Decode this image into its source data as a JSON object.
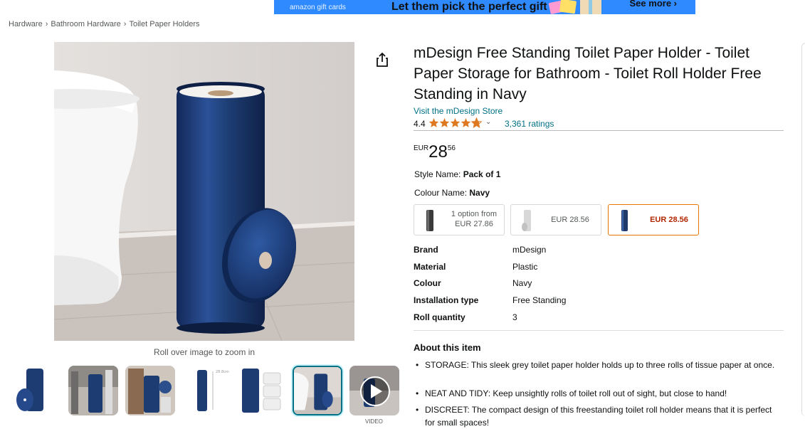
{
  "banner": {
    "small": "amazon gift cards",
    "headline": "Let them pick the perfect gift",
    "more": "See more ›"
  },
  "breadcrumb": [
    "Hardware",
    "Bathroom Hardware",
    "Toilet Paper Holders"
  ],
  "breadcrumb_sep": "›",
  "image": {
    "zoom_note": "Roll over image to zoom in",
    "video_label": "VIDEO",
    "selected_thumb": 6
  },
  "product": {
    "title": "mDesign Free Standing Toilet Paper Holder - Toilet Paper Storage for Bathroom - Toilet Roll Holder Free Standing in Navy",
    "store_link": "Visit the mDesign Store",
    "rating": "4.4",
    "rating_value": 4.4,
    "ratings_count": "3,361 ratings",
    "price": {
      "currency": "EUR",
      "whole": "28",
      "fraction": "56"
    }
  },
  "variants": {
    "style_label": "Style Name:",
    "style_value": "Pack of 1",
    "colour_label": "Colour Name:",
    "colour_value": "Navy",
    "swatches": [
      {
        "line1": "1 option from",
        "line2": "EUR 27.86",
        "color": "#3a3a3a"
      },
      {
        "price": "EUR 28.56",
        "color": "#d8d8d8"
      },
      {
        "price": "EUR 28.56",
        "color": "#1f3a6b",
        "selected": true
      }
    ]
  },
  "specs": [
    {
      "key": "Brand",
      "value": "mDesign"
    },
    {
      "key": "Material",
      "value": "Plastic"
    },
    {
      "key": "Colour",
      "value": "Navy"
    },
    {
      "key": "Installation type",
      "value": "Free Standing"
    },
    {
      "key": "Roll quantity",
      "value": "3"
    }
  ],
  "about": {
    "heading": "About this item",
    "bullets": [
      "STORAGE: This sleek grey toilet paper holder holds up to three rolls of tissue paper at once.",
      "NEAT AND TIDY: Keep unsightly rolls of toilet roll out of sight, but close to hand!",
      "DISCREET: The compact design of this freestanding toilet roll holder means that it is perfect for small spaces!"
    ]
  },
  "colors": {
    "link": "#007185",
    "star": "#de7921",
    "navy": "#1d3d72",
    "selected_border": "#e77600",
    "sale": "#b12704"
  }
}
